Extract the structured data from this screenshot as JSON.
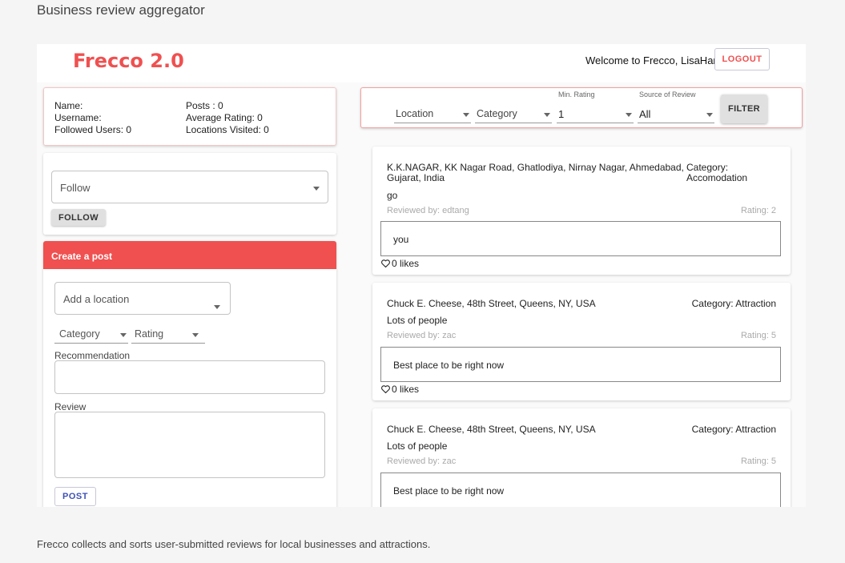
{
  "caption": {
    "title": "Business review aggregator",
    "description": "Frecco collects and sorts user-submitted reviews for local businesses and attractions."
  },
  "header": {
    "brand": "Frecco 2.0",
    "welcome": "Welcome to Frecco, LisaHan!",
    "logout_label": "LOGOUT"
  },
  "profile": {
    "name_label": "Name:",
    "username_label": "Username:",
    "followed_users": "Followed Users: 0",
    "posts": "Posts : 0",
    "average_rating": "Average Rating: 0",
    "locations_visited": "Locations Visited: 0"
  },
  "follow": {
    "placeholder": "Follow",
    "button_label": "FOLLOW"
  },
  "create_post": {
    "title": "Create a post",
    "location_placeholder": "Add a location",
    "category_placeholder": "Category",
    "rating_placeholder": "Rating",
    "recommendation_label": "Recommendation",
    "review_label": "Review",
    "post_label": "POST"
  },
  "filter": {
    "location_placeholder": "Location",
    "category_placeholder": "Category",
    "min_rating_label": "Min. Rating",
    "min_rating_value": "1",
    "source_label": "Source of Review",
    "source_value": "All",
    "button_label": "FILTER"
  },
  "reviews": [
    {
      "location_line1": "K.K.NAGAR, KK Nagar Road, Ghatlodiya, Nirnay Nagar, Ahmedabad,",
      "location_line2": "Gujarat, India",
      "category_line1": "Category:",
      "category_line2": "Accomodation",
      "title": "go",
      "reviewed_by": "Reviewed by: edtang",
      "rating": "Rating: 2",
      "text": "you",
      "likes": "0 likes"
    },
    {
      "location_line1": "Chuck E. Cheese, 48th Street, Queens, NY, USA",
      "category_line1": "Category: Attraction",
      "title": "Lots of people",
      "reviewed_by": "Reviewed by: zac",
      "rating": "Rating: 5",
      "text": "Best place to be right now",
      "likes": "0 likes"
    },
    {
      "location_line1": "Chuck E. Cheese, 48th Street, Queens, NY, USA",
      "category_line1": "Category: Attraction",
      "title": "Lots of people",
      "reviewed_by": "Reviewed by: zac",
      "rating": "Rating: 5",
      "text": "Best place to be right now"
    }
  ]
}
